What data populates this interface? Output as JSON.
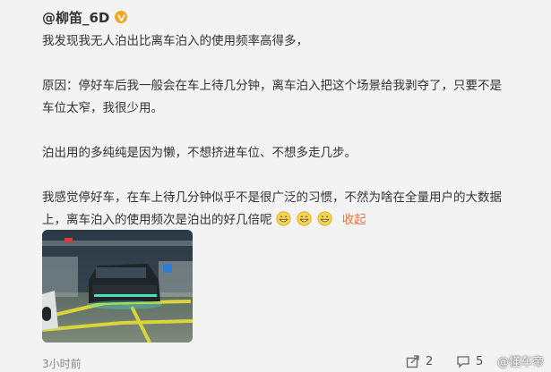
{
  "user": {
    "name": "@柳笛_6D"
  },
  "post": {
    "lines": [
      "我发现我无人泊出比离车泊入的使用频率高得多，",
      "",
      "原因：停好车后我一般会在车上待几分钟，离车泊入把这个场景给我剥夺了，只要不是",
      "车位太窄，我很少用。",
      "",
      "泊出用的多纯纯是因为懒，不想挤进车位、不想多走几步。",
      "",
      "我感觉停好车，在车上待几分钟似乎不是很广泛的习惯，不然为啥在全量用户的大数据",
      "上，离车泊入的使用频次是泊出的好几倍呢"
    ],
    "collapse_label": "收起",
    "emoji_icon": "grin-emoji-icon"
  },
  "footer": {
    "time": "3小时前",
    "share_count": "2",
    "comment_count": "5",
    "watermark": "@懂车帝"
  },
  "colors": {
    "accent": "#eb7340",
    "badge": "#f5a623",
    "background": "#f3f3f3"
  }
}
